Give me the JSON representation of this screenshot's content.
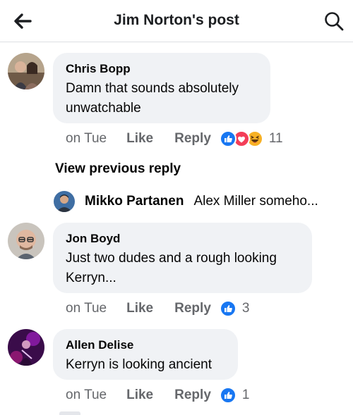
{
  "header": {
    "title": "Jim Norton's post",
    "back_icon": "arrow-left-icon",
    "search_icon": "search-icon"
  },
  "comments": [
    {
      "author": "Chris Bopp",
      "text_line1": "Damn that sounds absolutely",
      "text_line2": "unwatchable",
      "time": "on Tue",
      "like": "Like",
      "reply": "Reply",
      "reactions": [
        "like",
        "love",
        "haha"
      ],
      "reaction_count": "11"
    },
    {
      "author": "Jon Boyd",
      "text_line1": "Just two dudes and a rough looking",
      "text_line2": "Kerryn...",
      "time": "on Tue",
      "like": "Like",
      "reply": "Reply",
      "reactions": [
        "like"
      ],
      "reaction_count": "3"
    },
    {
      "author": "Allen Delise",
      "text_line1": "Kerryn is looking ancient",
      "time": "on Tue",
      "like": "Like",
      "reply": "Reply",
      "reactions": [
        "like"
      ],
      "reaction_count": "1"
    }
  ],
  "view_previous": "View previous reply",
  "reply_preview": {
    "name": "Mikko Partanen",
    "text": "Alex Miller someho..."
  },
  "colors": {
    "bubble": "#f0f2f5",
    "like_blue": "#1877f2",
    "love_red": "#f33e58",
    "haha_yellow": "#f7b125",
    "muted": "#65676b"
  }
}
